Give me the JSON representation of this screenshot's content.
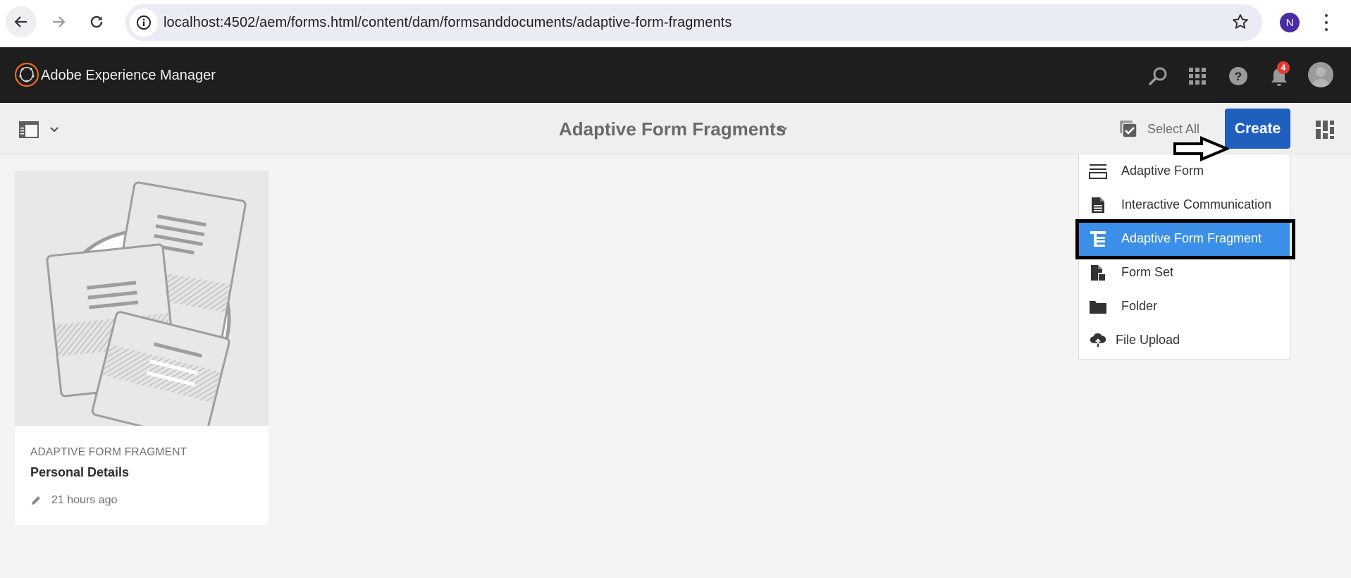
{
  "browser": {
    "url": "localhost:4502/aem/forms.html/content/dam/formsanddocuments/adaptive-form-fragments",
    "profile_initial": "N",
    "profile_color": "#4a2aa5"
  },
  "shell": {
    "app_title": "Adobe Experience Manager",
    "notification_count": "4",
    "icons": [
      "search-icon",
      "apps-grid-icon",
      "help-icon",
      "bell-icon",
      "user-avatar-icon"
    ]
  },
  "actionbar": {
    "page_title": "Adaptive Form Fragments",
    "select_all_label": "Select All",
    "create_label": "Create",
    "create_color": "#1f5fbd"
  },
  "cards": [
    {
      "type": "ADAPTIVE FORM FRAGMENT",
      "title": "Personal Details",
      "modified": "21 hours ago"
    }
  ],
  "create_menu": {
    "items": [
      {
        "label": "Adaptive Form",
        "icon": "adaptive-form-icon"
      },
      {
        "label": "Interactive Communication",
        "icon": "document-icon"
      },
      {
        "label": "Adaptive Form Fragment",
        "icon": "form-fragment-icon",
        "selected": true
      },
      {
        "label": "Form Set",
        "icon": "form-set-icon"
      },
      {
        "label": "Folder",
        "icon": "folder-icon"
      },
      {
        "label": "File Upload",
        "icon": "cloud-upload-icon"
      }
    ],
    "selected_color": "#3b8fe8"
  }
}
